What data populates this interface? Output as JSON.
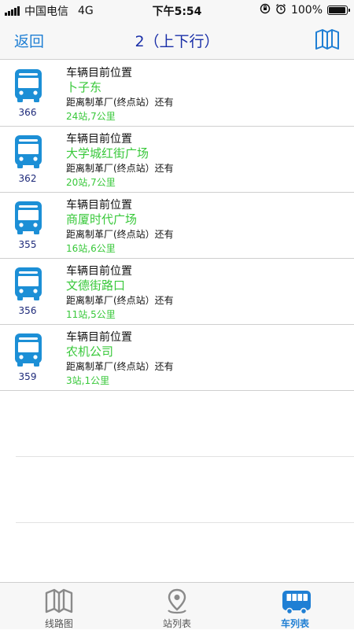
{
  "status_bar": {
    "carrier": "中国电信",
    "network": "4G",
    "time": "下午5:54",
    "battery_text": "100%",
    "battery_level": 1.0
  },
  "nav": {
    "back_label": "返回",
    "title": "2（上下行）",
    "right_icon": "map-icon"
  },
  "buses": [
    {
      "number": "366",
      "label": "车辆目前位置",
      "stop": "卜子东",
      "to_label": "距离制革厂(终点站）还有",
      "distance": "24站,7公里"
    },
    {
      "number": "362",
      "label": "车辆目前位置",
      "stop": "大学城红街广场",
      "to_label": "距离制革厂(终点站）还有",
      "distance": "20站,7公里"
    },
    {
      "number": "355",
      "label": "车辆目前位置",
      "stop": "商厦时代广场",
      "to_label": "距离制革厂(终点站）还有",
      "distance": "16站,6公里"
    },
    {
      "number": "356",
      "label": "车辆目前位置",
      "stop": "文德街路口",
      "to_label": "距离制革厂(终点站）还有",
      "distance": "11站,5公里"
    },
    {
      "number": "359",
      "label": "车辆目前位置",
      "stop": "农机公司",
      "to_label": "距离制革厂(终点站）还有",
      "distance": "3站,1公里"
    }
  ],
  "tabs": [
    {
      "label": "线路图",
      "icon": "map-icon",
      "active": false
    },
    {
      "label": "站列表",
      "icon": "location-pin-icon",
      "active": false
    },
    {
      "label": "车列表",
      "icon": "bus-icon",
      "active": true
    }
  ],
  "colors": {
    "accent": "#1f7fd4",
    "title": "#1a2fa8",
    "green": "#38c83a",
    "bus_blue": "#1c8fd6",
    "inactive_gray": "#8a8a8a"
  }
}
